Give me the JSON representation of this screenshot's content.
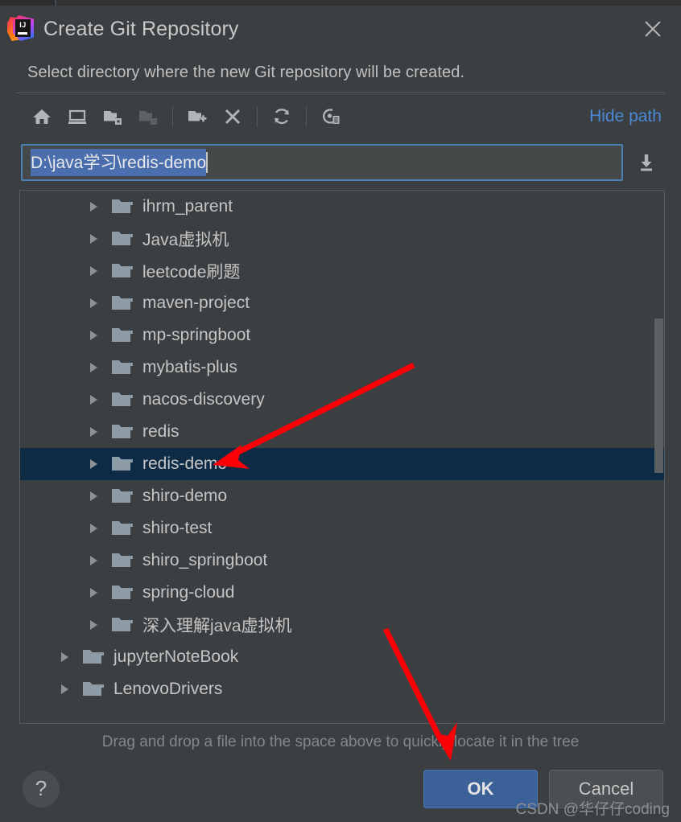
{
  "window": {
    "title": "Create Git Repository",
    "logo_icon": "intellij-idea-logo",
    "close_icon": "close-icon"
  },
  "subtitle": "Select directory where the new Git repository will be created.",
  "toolbar": {
    "buttons": [
      {
        "name": "home-icon",
        "tooltip": "Home",
        "enabled": true
      },
      {
        "name": "desktop-icon",
        "tooltip": "Desktop",
        "enabled": true
      },
      {
        "name": "folder-collapse-icon",
        "tooltip": "Collapse All",
        "enabled": true
      },
      {
        "name": "folder-expand-icon",
        "tooltip": "Expand All",
        "enabled": false
      },
      {
        "name": "new-folder-icon",
        "tooltip": "New Folder",
        "enabled": true
      },
      {
        "name": "delete-icon",
        "tooltip": "Delete",
        "enabled": true
      },
      {
        "name": "refresh-icon",
        "tooltip": "Refresh",
        "enabled": true
      },
      {
        "name": "show-hidden-files-icon",
        "tooltip": "Show Hidden Files",
        "enabled": true
      }
    ],
    "hide_path_label": "Hide path"
  },
  "path_field": {
    "value": "D:\\java学习\\redis-demo",
    "selected": true,
    "drop_icon": "insert-path-icon"
  },
  "tree": {
    "items": [
      {
        "label": "ihrm_parent",
        "level": 2,
        "selected": false,
        "expandable": true
      },
      {
        "label": "Java虚拟机",
        "level": 2,
        "selected": false,
        "expandable": true
      },
      {
        "label": "leetcode刷题",
        "level": 2,
        "selected": false,
        "expandable": true
      },
      {
        "label": "maven-project",
        "level": 2,
        "selected": false,
        "expandable": true
      },
      {
        "label": "mp-springboot",
        "level": 2,
        "selected": false,
        "expandable": true
      },
      {
        "label": "mybatis-plus",
        "level": 2,
        "selected": false,
        "expandable": true
      },
      {
        "label": "nacos-discovery",
        "level": 2,
        "selected": false,
        "expandable": true
      },
      {
        "label": "redis",
        "level": 2,
        "selected": false,
        "expandable": true
      },
      {
        "label": "redis-demo",
        "level": 2,
        "selected": true,
        "expandable": true
      },
      {
        "label": "shiro-demo",
        "level": 2,
        "selected": false,
        "expandable": true
      },
      {
        "label": "shiro-test",
        "level": 2,
        "selected": false,
        "expandable": true
      },
      {
        "label": "shiro_springboot",
        "level": 2,
        "selected": false,
        "expandable": true
      },
      {
        "label": "spring-cloud",
        "level": 2,
        "selected": false,
        "expandable": true
      },
      {
        "label": "深入理解java虚拟机",
        "level": 2,
        "selected": false,
        "expandable": true
      },
      {
        "label": "jupyterNoteBook",
        "level": 1,
        "selected": false,
        "expandable": true
      },
      {
        "label": "LenovoDrivers",
        "level": 1,
        "selected": false,
        "expandable": true
      }
    ],
    "scrollbar": {
      "thumb_top_pct": 24,
      "thumb_height_pct": 29
    }
  },
  "hint": "Drag and drop a file into the space above to quickly locate it in the tree",
  "footer": {
    "help_label": "?",
    "ok_label": "OK",
    "cancel_label": "Cancel"
  },
  "watermark": "CSDN @华仔仔coding",
  "colors": {
    "dialog_bg": "#3c3f41",
    "text": "#c5c5c5",
    "link": "#4a88d8",
    "selection_row": "#0d2b45",
    "text_selection": "#4b6eaf",
    "focus_border": "#4b7fb5",
    "default_button": "#3c6098",
    "folder_icon": "#8c9ba5",
    "annotation_arrow": "#fb0007"
  }
}
